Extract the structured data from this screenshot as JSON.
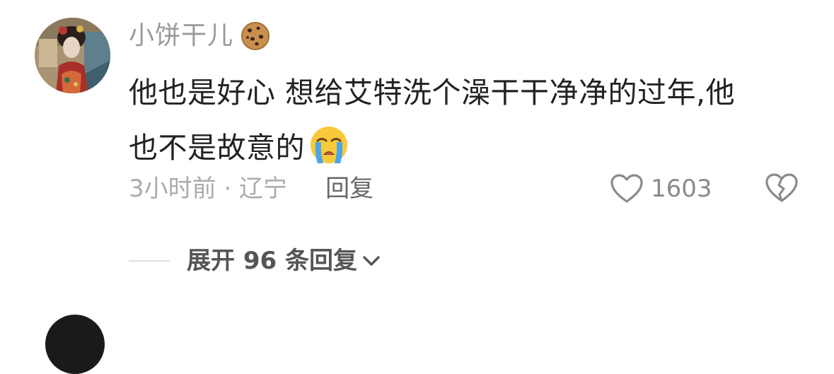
{
  "comment": {
    "username": "小饼干儿",
    "badge_icon": "cookie-icon",
    "text_line1": "他也是好心 想给艾特洗个澡干干净净的过年,他",
    "text_line2": "也不是故意的",
    "text_emoji": "crying-face-icon",
    "time_location": "3小时前 · 辽宁",
    "reply_label": "回复",
    "like_icon": "heart-outline-icon",
    "like_count": "1603",
    "dislike_icon": "broken-heart-icon"
  },
  "replies": {
    "expand_label": "展开 96 条回复",
    "expand_icon": "chevron-down-icon"
  },
  "colors": {
    "text_primary": "#222222",
    "text_secondary": "#9a9a9a",
    "text_muted": "#ababab",
    "reply_text": "#666666",
    "background": "#ffffff"
  }
}
